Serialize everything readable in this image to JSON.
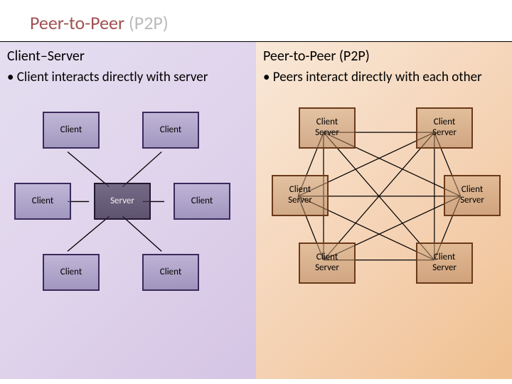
{
  "title": {
    "main": "Peer-to-Peer ",
    "paren": "(P2P)"
  },
  "left": {
    "heading": "Client–Server",
    "bullet": "Client interacts directly with server",
    "nodes": {
      "tl": "Client",
      "tr": "Client",
      "ml": "Client",
      "mc": "Server",
      "mr": "Client",
      "bl": "Client",
      "br": "Client"
    }
  },
  "right": {
    "heading": "Peer-to-Peer (P2P)",
    "bullet": "Peers interact directly with each other",
    "nodes": {
      "tl": {
        "a": "Client",
        "b": "Server"
      },
      "tr": {
        "a": "Client",
        "b": "Server"
      },
      "ml": {
        "a": "Client",
        "b": "Server"
      },
      "mr": {
        "a": "Client",
        "b": "Server"
      },
      "bl": {
        "a": "Client",
        "b": "Server"
      },
      "br": {
        "a": "Client",
        "b": "Server"
      }
    }
  }
}
